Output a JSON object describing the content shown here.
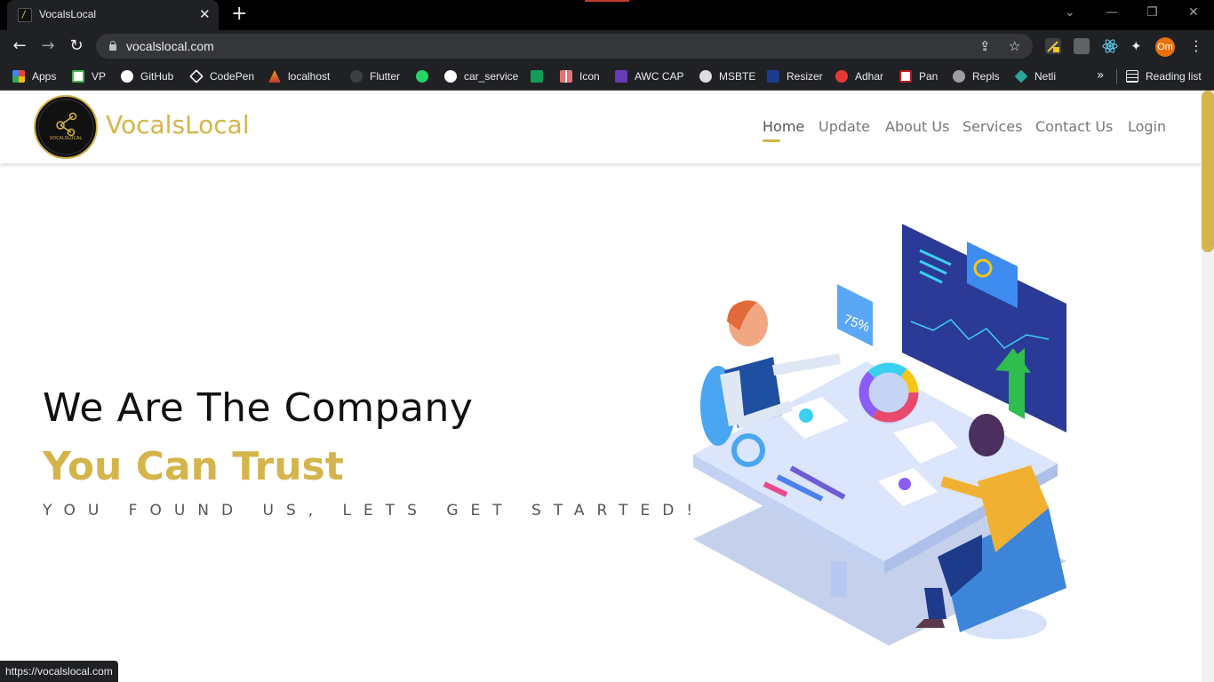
{
  "browser": {
    "tab_title": "VocalsLocal",
    "tab_close": "✕",
    "new_tab": "+",
    "url": "vocalslocal.com",
    "profile_initials": "Om",
    "status_url": "https://vocalslocal.com"
  },
  "bookmarks": [
    {
      "label": "Apps",
      "icon": "apps-grid-icon",
      "color": "#ea4335"
    },
    {
      "label": "VP",
      "icon": "vp-icon",
      "color": "#4caf50"
    },
    {
      "label": "GitHub",
      "icon": "github-icon",
      "color": "#ffffff"
    },
    {
      "label": "CodePen",
      "icon": "codepen-icon",
      "color": "#ffffff"
    },
    {
      "label": "localhost",
      "icon": "localhost-icon",
      "color": "#f0a030"
    },
    {
      "label": "Flutter",
      "icon": "flutter-icon",
      "color": "#555555"
    },
    {
      "label": "",
      "icon": "whatsapp-icon",
      "color": "#25d366"
    },
    {
      "label": "car_service",
      "icon": "github-icon",
      "color": "#ffffff"
    },
    {
      "label": "",
      "icon": "sheets-icon",
      "color": "#0f9d58"
    },
    {
      "label": "Icon",
      "icon": "icon-site-icon",
      "color": "#e57373"
    },
    {
      "label": "AWC CAP",
      "icon": "awc-icon",
      "color": "#673ab7"
    },
    {
      "label": "MSBTE",
      "icon": "msbte-icon",
      "color": "#dddddd"
    },
    {
      "label": "Resizer",
      "icon": "resizer-icon",
      "color": "#1e3a8a"
    },
    {
      "label": "Adhar",
      "icon": "adhar-icon",
      "color": "#e53935"
    },
    {
      "label": "Pan",
      "icon": "pan-icon",
      "color": "#b71c1c"
    },
    {
      "label": "Repls",
      "icon": "repls-icon",
      "color": "#9e9e9e"
    },
    {
      "label": "Netli",
      "icon": "netlify-icon",
      "color": "#26a69a"
    }
  ],
  "bookmarks_more": "»",
  "reading_list": "Reading list",
  "site": {
    "brand": "VocalsLocal",
    "logo_text": "VOCALSLOCAL",
    "nav": [
      "Home",
      "Update",
      "About Us",
      "Services",
      "Contact Us",
      "Login"
    ],
    "active_nav": "Home",
    "hero_line1": "We Are The Company",
    "hero_line2": "You Can Trust",
    "hero_line3": "YOU FOUND US, LETS GET STARTED!",
    "illustration_badge": "75%"
  },
  "colors": {
    "accent": "#d4b54c",
    "chrome_bg": "#202124"
  }
}
